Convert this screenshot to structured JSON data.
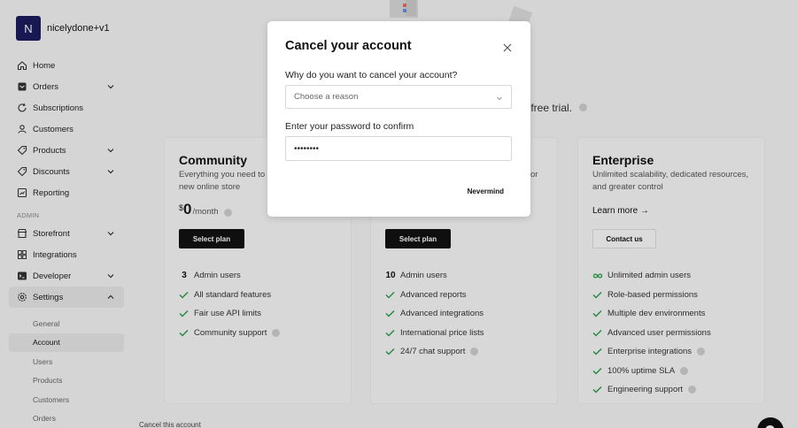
{
  "user": {
    "initial": "N",
    "name": "nicelydone+v1"
  },
  "nav": {
    "items": [
      {
        "label": "Home",
        "icon": "home-icon",
        "chevron": false
      },
      {
        "label": "Orders",
        "icon": "orders-icon",
        "chevron": true
      },
      {
        "label": "Subscriptions",
        "icon": "subscriptions-icon",
        "chevron": false
      },
      {
        "label": "Customers",
        "icon": "customers-icon",
        "chevron": false
      },
      {
        "label": "Products",
        "icon": "products-icon",
        "chevron": true
      },
      {
        "label": "Discounts",
        "icon": "discounts-icon",
        "chevron": true
      },
      {
        "label": "Reporting",
        "icon": "reporting-icon",
        "chevron": false
      }
    ],
    "admin_label": "ADMIN",
    "admin_items": [
      {
        "label": "Storefront",
        "icon": "storefront-icon",
        "chevron": true
      },
      {
        "label": "Integrations",
        "icon": "integrations-icon",
        "chevron": false
      },
      {
        "label": "Developer",
        "icon": "developer-icon",
        "chevron": true
      },
      {
        "label": "Settings",
        "icon": "settings-icon",
        "chevron": true,
        "active": true
      }
    ],
    "settings_sub": [
      {
        "label": "General"
      },
      {
        "label": "Account",
        "active": true
      },
      {
        "label": "Users"
      },
      {
        "label": "Products"
      },
      {
        "label": "Customers"
      },
      {
        "label": "Orders"
      }
    ]
  },
  "page": {
    "trial_text": "y free trial.",
    "cancel_link": "Cancel this account"
  },
  "plans": {
    "community": {
      "title": "Community",
      "desc": "Everything you need to f",
      "desc2": "new online store",
      "currency": "$",
      "amount": "0",
      "period": "/month",
      "button": "Select plan",
      "features": [
        {
          "num": "3",
          "label": "Admin users"
        },
        {
          "label": "All standard features"
        },
        {
          "label": "Fair use API limits"
        },
        {
          "label": "Community support",
          "info": true
        }
      ]
    },
    "growth": {
      "desc_fragment": "or",
      "button": "Select plan",
      "features": [
        {
          "num": "10",
          "label": "Admin users"
        },
        {
          "label": "Advanced reports"
        },
        {
          "label": "Advanced integrations"
        },
        {
          "label": "International price lists"
        },
        {
          "label": "24/7 chat support",
          "info": true
        }
      ]
    },
    "enterprise": {
      "title": "Enterprise",
      "desc": "Unlimited scalability, dedicated resources, and greater control",
      "learn_more": "Learn more →",
      "button": "Contact us",
      "features": [
        {
          "label": "Unlimited admin users",
          "icon": "infinity-icon"
        },
        {
          "label": "Role-based permissions"
        },
        {
          "label": "Multiple dev environments"
        },
        {
          "label": "Advanced user permissions"
        },
        {
          "label": "Enterprise integrations",
          "info": true
        },
        {
          "label": "100% uptime SLA",
          "info": true
        },
        {
          "label": "Engineering support",
          "info": true
        }
      ]
    }
  },
  "modal": {
    "title": "Cancel your account",
    "reason_label": "Why do you want to cancel your account?",
    "reason_placeholder": "Choose a reason",
    "password_label": "Enter your password to confirm",
    "password_value": "••••••••",
    "nevermind": "Nevermind"
  },
  "colors": {
    "check": "#2e9e4f",
    "dark_button": "#121212",
    "avatar": "#1c1d5e"
  }
}
